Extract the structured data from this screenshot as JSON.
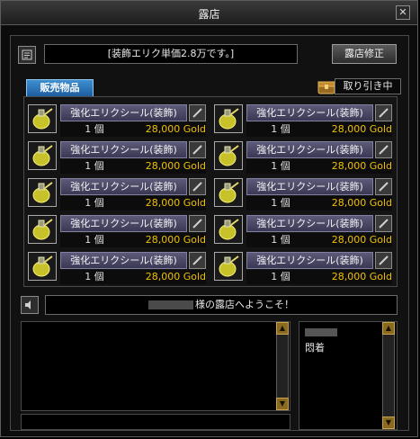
{
  "window": {
    "title": "露店",
    "close_glyph": "✕"
  },
  "shop": {
    "notice": "[装飾エリク単価2.8万です。]",
    "edit_button": "露店修正",
    "tab_label": "販売物品",
    "trade_button": "取り引き中"
  },
  "items": [
    {
      "name": "強化エリクシール(装飾)",
      "quantity": "1 個",
      "price": "28,000 Gold"
    },
    {
      "name": "強化エリクシール(装飾)",
      "quantity": "1 個",
      "price": "28,000 Gold"
    },
    {
      "name": "強化エリクシール(装飾)",
      "quantity": "1 個",
      "price": "28,000 Gold"
    },
    {
      "name": "強化エリクシール(装飾)",
      "quantity": "1 個",
      "price": "28,000 Gold"
    },
    {
      "name": "強化エリクシール(装飾)",
      "quantity": "1 個",
      "price": "28,000 Gold"
    },
    {
      "name": "強化エリクシール(装飾)",
      "quantity": "1 個",
      "price": "28,000 Gold"
    },
    {
      "name": "強化エリクシール(装飾)",
      "quantity": "1 個",
      "price": "28,000 Gold"
    },
    {
      "name": "強化エリクシール(装飾)",
      "quantity": "1 個",
      "price": "28,000 Gold"
    },
    {
      "name": "強化エリクシール(装飾)",
      "quantity": "1 個",
      "price": "28,000 Gold"
    },
    {
      "name": "強化エリクシール(装飾)",
      "quantity": "1 個",
      "price": "28,000 Gold"
    }
  ],
  "welcome": {
    "text": "様の露店へようこそ！"
  },
  "visitors": {
    "second_line": "悶着"
  },
  "icons": {
    "notice": "memo-icon",
    "trade": "treasure-chest-icon",
    "item": "elixir-potion-icon",
    "edit": "pencil-icon",
    "speaker": "speaker-icon"
  },
  "colors": {
    "price": "#f0c000",
    "tab": "#2a76ba",
    "item_name_bg": "#4a4866"
  }
}
